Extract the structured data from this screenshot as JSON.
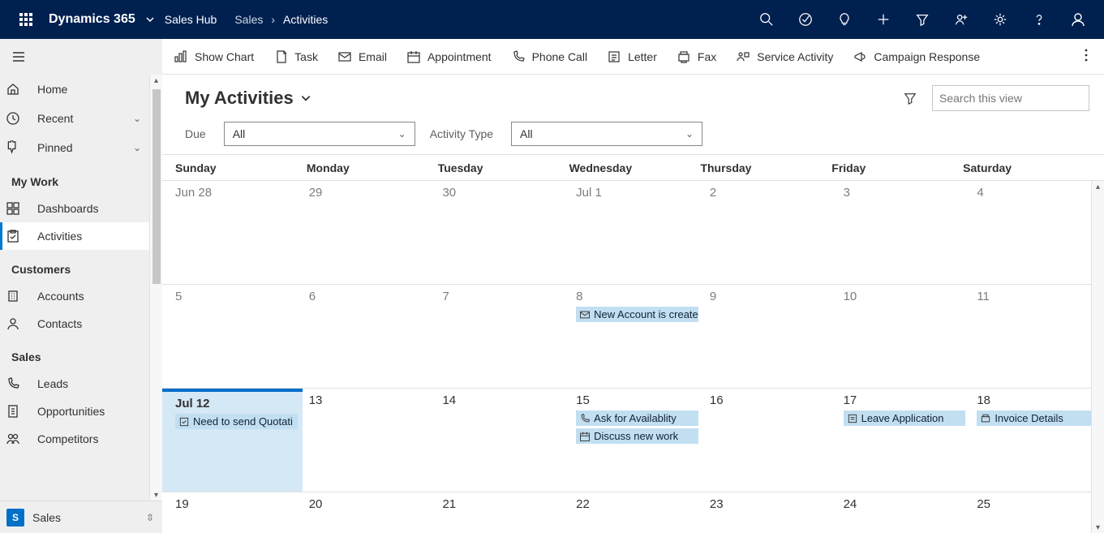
{
  "header": {
    "brand": "Dynamics 365",
    "appname": "Sales Hub",
    "crumb1": "Sales",
    "crumb2": "Activities"
  },
  "sidebar": {
    "home": "Home",
    "recent": "Recent",
    "pinned": "Pinned",
    "group_mywork": "My Work",
    "dashboards": "Dashboards",
    "activities": "Activities",
    "group_customers": "Customers",
    "accounts": "Accounts",
    "contacts": "Contacts",
    "group_sales": "Sales",
    "leads": "Leads",
    "opportunities": "Opportunities",
    "competitors": "Competitors",
    "area_badge": "S",
    "area_label": "Sales"
  },
  "commands": {
    "showchart": "Show Chart",
    "task": "Task",
    "email": "Email",
    "appointment": "Appointment",
    "phonecall": "Phone Call",
    "letter": "Letter",
    "fax": "Fax",
    "serviceactivity": "Service Activity",
    "campaignresponse": "Campaign Response"
  },
  "view": {
    "title": "My Activities",
    "due_label": "Due",
    "due_value": "All",
    "type_label": "Activity Type",
    "type_value": "All",
    "search_placeholder": "Search this view"
  },
  "calendar": {
    "dayheaders": {
      "sun": "Sunday",
      "mon": "Monday",
      "tue": "Tuesday",
      "wed": "Wednesday",
      "thu": "Thursday",
      "fri": "Friday",
      "sat": "Saturday"
    },
    "w1": {
      "d0": "Jun 28",
      "d1": "29",
      "d2": "30",
      "d3": "Jul 1",
      "d4": "2",
      "d5": "3",
      "d6": "4"
    },
    "w2": {
      "d0": "5",
      "d1": "6",
      "d2": "7",
      "d3": "8",
      "d4": "9",
      "d5": "10",
      "d6": "11"
    },
    "w3": {
      "d0": "Jul 12",
      "d1": "13",
      "d2": "14",
      "d3": "15",
      "d4": "16",
      "d5": "17",
      "d6": "18"
    },
    "w4": {
      "d0": "19",
      "d1": "20",
      "d2": "21",
      "d3": "22",
      "d4": "23",
      "d5": "24",
      "d6": "25"
    }
  },
  "events": {
    "new_account": "New Account is create",
    "quotation": "Need to send Quotati",
    "ask_avail": "Ask for Availablity",
    "discuss": "Discuss new work",
    "leave": "Leave Application",
    "invoice": "Invoice Details"
  }
}
